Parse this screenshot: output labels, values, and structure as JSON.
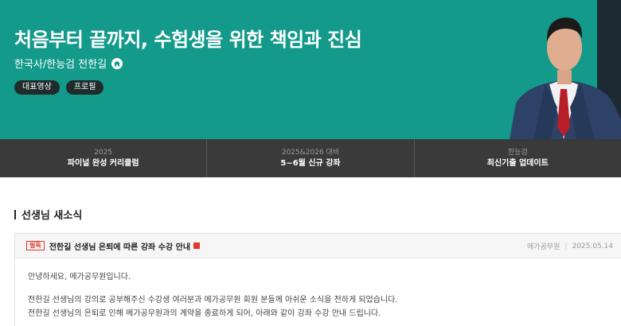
{
  "hero": {
    "title": "처음부터 끝까지, 수험생을 위한 책임과 진심",
    "subtitle": "한국사/한능검 전한길",
    "tags": [
      "대표영상",
      "프로필"
    ],
    "colors": {
      "background": "#139a8a",
      "tag_bg": "#1f2c2b"
    }
  },
  "nav": {
    "items": [
      {
        "top": "2025",
        "main": "파이널 완성 커리큘럼"
      },
      {
        "top": "2025&2026 대비",
        "main": "5~6월 신규 강좌"
      },
      {
        "top": "한능검",
        "main": "최신기출 업데이트"
      }
    ]
  },
  "section": {
    "title": "선생님 새소식"
  },
  "notice": {
    "badge": "필독",
    "title": "전한길 선생님 은퇴에 따른 강좌 수강 안내",
    "author": "메가공무원",
    "date": "2025.05.14",
    "body": [
      "안녕하세요, 메가공무원입니다.",
      "전한길 선생님의 강의로 공부해주신 수강생 여러분과 메가공무원 회원 분들께 아쉬운 소식을 전하게 되었습니다.",
      "전한길 선생님의 은퇴로 인해 메가공무원과의 계약을 종료하게 되어, 아래와 같이 강좌 수강 안내 드립니다."
    ]
  },
  "icons": [
    "home-icon",
    "new-icon"
  ]
}
